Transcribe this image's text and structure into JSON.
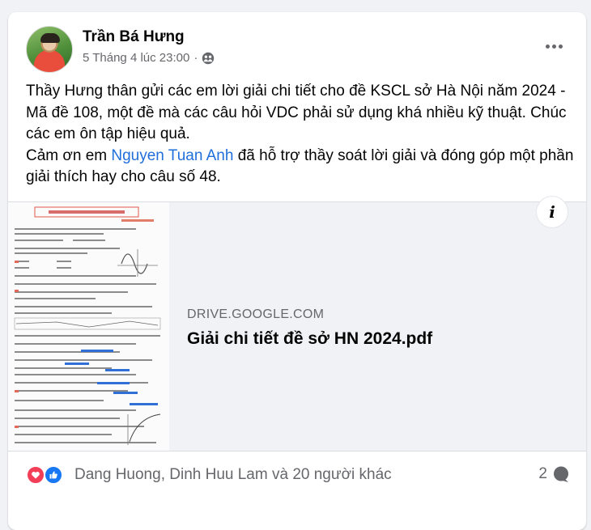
{
  "post": {
    "author": "Trần Bá Hưng",
    "timestamp": "5 Tháng 4 lúc 23:00",
    "separator": "·",
    "audience_icon": "friends-icon",
    "text_line1": "Thầy Hưng thân gửi các em lời giải chi tiết cho đề KSCL sở Hà Nội năm 2024 - Mã đề 108, một đề mà các câu hỏi VDC phải sử dụng khá nhiều kỹ thuật. Chúc các em ôn tập hiệu quả.",
    "text_line2_before": "Cảm ơn em ",
    "mention": "Nguyen Tuan Anh",
    "text_line2_after": " đã hỗ trợ thầy soát lời giải và đóng góp một phần giải thích hay cho câu số 48."
  },
  "attachment": {
    "domain": "DRIVE.GOOGLE.COM",
    "title": "Giải chi tiết đề sở HN 2024.pdf",
    "info_icon": "i"
  },
  "footer": {
    "reaction_icons": [
      "love-icon",
      "like-icon"
    ],
    "reactions_text": "Dang Huong, Dinh Huu Lam và 20 người khác",
    "comment_count": "2"
  },
  "colors": {
    "love": "#f33e58",
    "like": "#1877f2",
    "mention": "#216fdb",
    "secondary_text": "#65676b"
  }
}
